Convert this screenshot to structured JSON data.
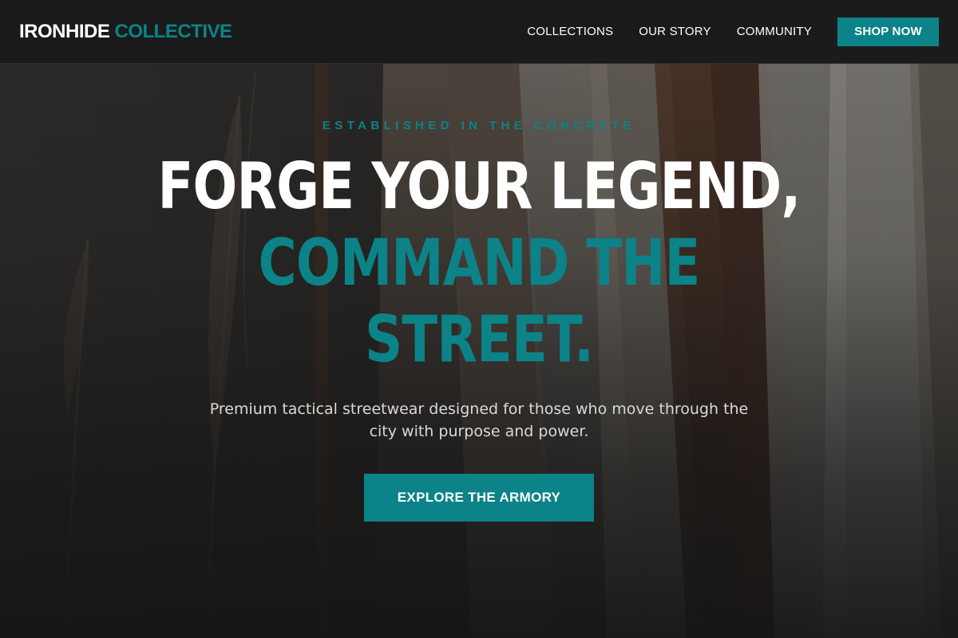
{
  "brand": {
    "name_part1": "IRONHIDE",
    "name_part2": "COLLECTIVE",
    "accent_color": "#0b8388"
  },
  "nav": {
    "links": [
      "COLLECTIONS",
      "OUR STORY",
      "COMMUNITY"
    ],
    "cta_label": "SHOP NOW"
  },
  "hero": {
    "eyebrow": "ESTABLISHED IN THE CONCRETE",
    "headline_line1": "FORGE YOUR LEGEND,",
    "headline_line2": "COMMAND THE",
    "headline_line3": "STREET.",
    "subtitle": "Premium tactical streetwear designed for those who move through the city with purpose and power.",
    "cta_label": "EXPLORE THE ARMORY"
  },
  "colors": {
    "background": "#141414",
    "nav_background": "#1a1a1a",
    "accent": "#0b8388",
    "text": "#ffffff"
  }
}
